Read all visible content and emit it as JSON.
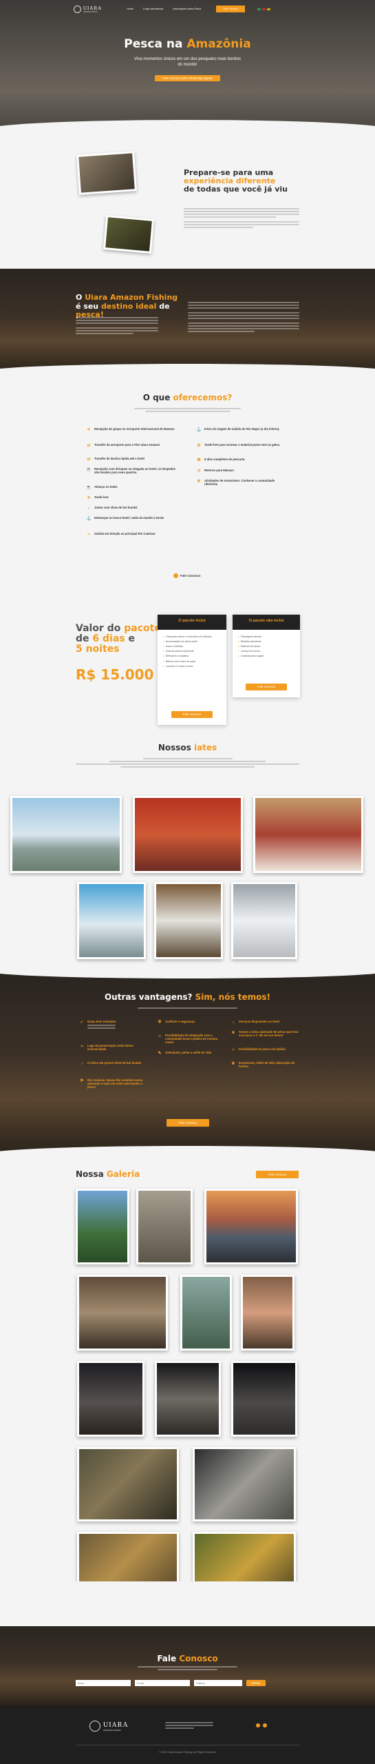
{
  "nav": {
    "brand": "UIARA",
    "brand_sub": "AMAZON FISHING",
    "items": [
      "Home",
      "O que oferecemos",
      "Informações sobre Pesca"
    ],
    "cta": "Fale Conosco"
  },
  "hero": {
    "title_a": "Pesca na ",
    "title_b": "Amazônia",
    "subtitle": "Viva momentos únicos em um dos pesqueiro mais bonitos do mundo!",
    "button": "Fale conosco pelo WhatsApp agora!"
  },
  "prepare": {
    "title_a": "Prepare-se para uma",
    "title_b": "experiência diferente",
    "title_c": "de todas que você já viu"
  },
  "about": {
    "title_a": "O ",
    "title_b": "Uiara Amazon Fishing",
    "title_c": "é seu ",
    "title_d": "destino ideal",
    "title_e": " de ",
    "title_f": "pesca!"
  },
  "offer": {
    "title_a": "O que ",
    "title_b": "oferecemos?",
    "left": [
      "Recepção do grupo no Aeroporto Internacional de Manaus",
      "Transfer do aeroporto para o Flor Uiara Amazon",
      "Transfer de lancha rápida até o hotel",
      "Recepção com drinques na chegada ao hotel; os hóspedes são levados para seus quartos.",
      "Almoço no hotel.",
      "Tarde livre",
      "Jantar com show de boi bumbá",
      "Embarque no barco-hotel; saída da manhã a bordo",
      "Subida em Direção ao principal Rio Camicas"
    ],
    "right": [
      "Início da viagem de subida do Rio Negro (a dia inteiro).",
      "Tarde livre para arrumar o material posto sem os gelos.",
      "5 dias completos de pescaria.",
      "Retorno para Manaus",
      "Atividades de ecoturismo: Conhecer a comunidade ribeirinha"
    ],
    "contact": "Fale Conosco"
  },
  "pricing": {
    "title_a": "Valor do ",
    "title_b": "pacote",
    "title_c": "de ",
    "title_d": "6 dias",
    "title_e": " e",
    "title_f": "5 noites",
    "price": "R$ 15.000",
    "card1": {
      "title": "O pacote inclui",
      "items": [
        "Transporte aéreo e rodoviário em Manaus",
        "Acomodação em barco-hotel",
        "Iscas e bebidas",
        "Guia de pesca experiente",
        "Refeições completas",
        "Barcos com motor de popa",
        "Lanches e frutas a bordo"
      ],
      "button": "Fale conosco"
    },
    "card2": {
      "title": "O pacote não inclui",
      "items": [
        "Passagens aéreas",
        "Bebidas alcoólicas",
        "Material de pesca",
        "Licença de pesca",
        "Gorjetas para equipe"
      ],
      "button": "Fale conosco"
    }
  },
  "yachts": {
    "title_a": "Nossos ",
    "title_b": "iates"
  },
  "advantages": {
    "title_a": "Outras vantagens? ",
    "title_b": "Sim, nós temos!",
    "col1": [
      "Guias bem treinados",
      "Lago de preservação onde temos exclusividade",
      "O Único em possui show de boi bumbá",
      "Rio Camicas: Nosso Rio somente nossa operação e mais um outro autorizados a pesca"
    ],
    "col2": [
      "Conforto e segurança",
      "Possibilidade de integração com a comunidade local e prática de turismo social",
      "Artesanato, pintar a estilo de vida"
    ],
    "col3": [
      "Serviços disponíveis no hotel",
      "Somos a única operação de pesca que leva você para o 1º dia em um Resort",
      "Possibilidade de pesca em família",
      "Ecoturismo, estilo de vida, fabricação de farinha"
    ],
    "button": "Fale conosco"
  },
  "gallery": {
    "title_a": "Nossa ",
    "title_b": "Galeria",
    "button": "Fale conosco"
  },
  "contact": {
    "title_a": "Fale ",
    "title_b": "Conosco",
    "fields": [
      "Nome",
      "E-mail",
      "Telefone"
    ],
    "button": "Enviar"
  },
  "footer": {
    "brand": "UIARA",
    "brand_sub": "AMAZON FISHING",
    "copyright": "© 2023 Uiara Amazon Fishing | All Rights Reserved"
  },
  "colors": {
    "accent": "#f39c1f",
    "dark": "#2a2520",
    "light": "#f4f4f4"
  }
}
